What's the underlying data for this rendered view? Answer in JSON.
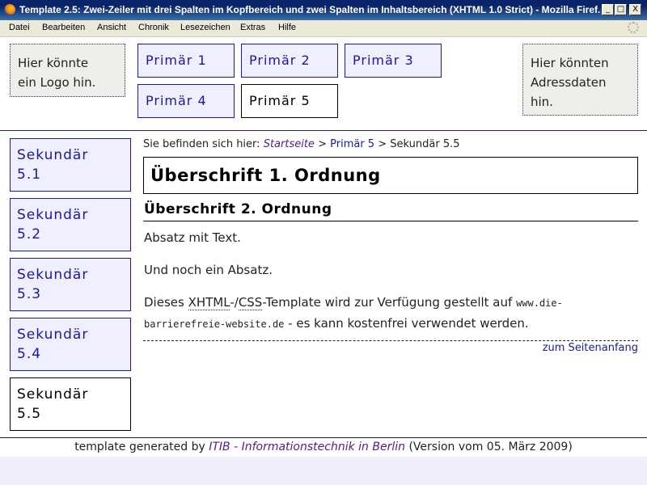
{
  "window": {
    "title": "Template 2.5: Zwei-Zeiler mit drei Spalten im Kopfbereich und zwei Spalten im Inhaltsbereich (XHTML 1.0 Strict) - Mozilla Firef...",
    "buttons": {
      "minimize": "_",
      "maximize": "□",
      "close": "X"
    }
  },
  "menu": [
    "Datei",
    "Bearbeiten",
    "Ansicht",
    "Chronik",
    "Lesezeichen",
    "Extras",
    "Hilfe"
  ],
  "header": {
    "logo_line1": "Hier könnte",
    "logo_line2": "ein Logo hin.",
    "address_line1": "Hier könnten",
    "address_line2": "Adressdaten",
    "address_line3": "hin.",
    "primary_nav": [
      "Primär 1",
      "Primär 2",
      "Primär 3",
      "Primär 4",
      "Primär 5"
    ],
    "primary_active": "Primär 5"
  },
  "sidebar": {
    "items": [
      {
        "line1": "Sekundär",
        "line2": "5.1"
      },
      {
        "line1": "Sekundär",
        "line2": "5.2"
      },
      {
        "line1": "Sekundär",
        "line2": "5.3"
      },
      {
        "line1": "Sekundär",
        "line2": "5.4"
      },
      {
        "line1": "Sekundär",
        "line2": "5.5"
      }
    ],
    "active_index": 4
  },
  "breadcrumb": {
    "prefix": "Sie befinden sich hier:",
    "home": "Startseite",
    "sep": ">",
    "level1": "Primär 5",
    "current": "Sekundär 5.5"
  },
  "main": {
    "h1": "Überschrift 1. Ordnung",
    "h2": "Überschrift 2. Ordnung",
    "para1": "Absatz mit Text.",
    "para2": "Und noch ein Absatz.",
    "para3_pre": "Dieses ",
    "para3_abbr1": "XHTML",
    "para3_mid1": "-/",
    "para3_abbr2": "CSS",
    "para3_mid2": "-Template wird zur Verfügung gestellt auf ",
    "para3_url1": "www.die-",
    "para3_url2": "barrierefreie-website.de",
    "para3_post": " - es kann kostenfrei verwendet werden.",
    "to_top": "zum Seitenanfang"
  },
  "footer": {
    "pre": "template generated by ",
    "link": "ITIB - Informationstechnik in Berlin",
    "post": " (Version vom 05. März 2009)"
  }
}
